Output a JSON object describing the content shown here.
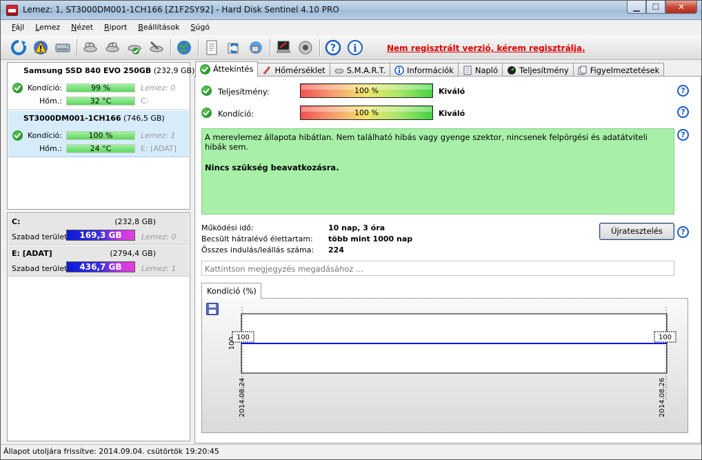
{
  "window": {
    "title": "Lemez: 1, ST3000DM001-1CH166 [Z1F2SY92]  -  Hard Disk Sentinel 4.10 PRO"
  },
  "menu": [
    "Fájl",
    "Lemez",
    "Nézet",
    "Riport",
    "Beállítások",
    "Súgó"
  ],
  "menu_accel": [
    "F",
    "L",
    "N",
    "R",
    "B",
    "S"
  ],
  "toolbar": {
    "registration_warning": "Nem regisztrált verzió, kérem regisztrálja."
  },
  "disks": [
    {
      "name": "Samsung SSD 840 EVO 250GB",
      "size": "(232,9 GB)",
      "condition_label": "Kondíció:",
      "condition": "99 %",
      "condition_pct": 99,
      "drive_index": "Lemez: 0",
      "temp_label": "Hőm.:",
      "temp": "32 °C",
      "volumes": "C:"
    },
    {
      "name": "ST3000DM001-1CH166",
      "size": "(746,5 GB)",
      "condition_label": "Kondíció:",
      "condition": "100 %",
      "condition_pct": 100,
      "drive_index": "Lemez: 1",
      "temp_label": "Hőm.:",
      "temp": "24 °C",
      "volumes": "E: [ADAT]"
    }
  ],
  "volumes": [
    {
      "name": "C:",
      "size": "(232,8 GB)",
      "free_label": "Szabad terület",
      "free": "169,3 GB",
      "disk": "Lemez: 0"
    },
    {
      "name": "E: [ADAT]",
      "size": "(2794,4 GB)",
      "free_label": "Szabad terület",
      "free": "436,7 GB",
      "disk": "Lemez: 1"
    }
  ],
  "tabs": [
    "Áttekintés",
    "Hőmérséklet",
    "S.M.A.R.T.",
    "Információk",
    "Napló",
    "Teljesítmény",
    "Figyelmeztetések"
  ],
  "overview": {
    "performance_label": "Teljesítmény:",
    "performance": "100 %",
    "performance_pct": 100,
    "performance_rating": "Kiváló",
    "condition_label": "Kondíció:",
    "condition": "100 %",
    "condition_pct": 100,
    "condition_rating": "Kiváló",
    "message": "A merevlemez állapota hibátlan. Nem található hibás vagy gyenge szektor, nincsenek felpörgési és adatátviteli hibák sem.",
    "message_action": "Nincs szükség beavatkozásra.",
    "uptime_label": "Működési idő:",
    "uptime": "10 nap, 3 óra",
    "lifetime_label": "Becsült hátralévő élettartam:",
    "lifetime": "több mint 1000 nap",
    "startstop_label": "Összes indulás/leállás száma:",
    "startstop": "224",
    "retest_button": "Újratesztelés",
    "note_placeholder": "Kattintson megjegyzés megadásához ..."
  },
  "help_symbol": "?",
  "chart_data": {
    "type": "line",
    "title": "Kondíció  (%)",
    "x": [
      "2014.08.24",
      "2014.08.26"
    ],
    "series": [
      {
        "values": [
          100,
          100
        ]
      }
    ],
    "ylabel": "",
    "xlabel": "",
    "ytick": "100",
    "point_labels": [
      "100",
      "100"
    ],
    "ylim": [
      0,
      200
    ],
    "line_color": "#0000ff"
  },
  "status": {
    "text": "Állapot utoljára frissítve: 2014.09.04. csütörtök 19:20:45"
  }
}
